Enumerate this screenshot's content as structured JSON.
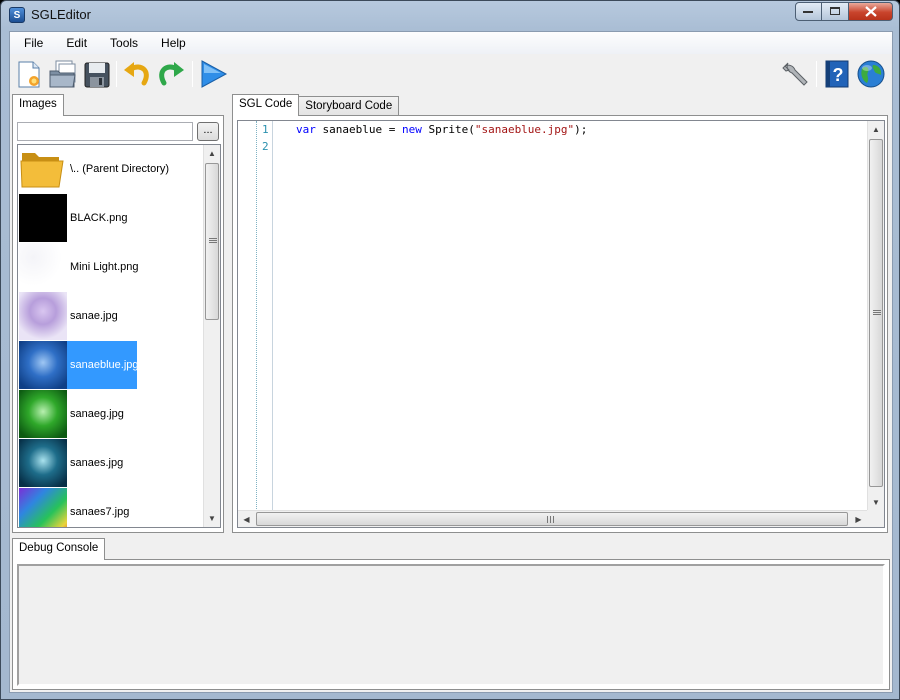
{
  "window": {
    "title": "SGLEditor"
  },
  "menubar": {
    "items": [
      "File",
      "Edit",
      "Tools",
      "Help"
    ]
  },
  "toolbar": {
    "buttons": [
      "new-file-icon",
      "open-folder-icon",
      "save-disk-icon",
      "undo-icon",
      "redo-icon",
      "run-play-icon"
    ],
    "right_buttons": [
      "wrench-icon",
      "help-book-icon",
      "globe-icon"
    ]
  },
  "images_panel": {
    "tab_label": "Images",
    "search_value": "",
    "browse_label": "...",
    "files": [
      {
        "name": "\\.. (Parent Directory)",
        "thumb": "folder"
      },
      {
        "name": "BLACK.png",
        "thumb": "black"
      },
      {
        "name": "Mini Light.png",
        "thumb": "light"
      },
      {
        "name": "sanae.jpg",
        "thumb": "sanae"
      },
      {
        "name": "sanaeblue.jpg",
        "thumb": "blue",
        "selected": true
      },
      {
        "name": "sanaeg.jpg",
        "thumb": "green"
      },
      {
        "name": "sanaes.jpg",
        "thumb": "teal"
      },
      {
        "name": "sanaes7.jpg",
        "thumb": "rainbow"
      }
    ]
  },
  "editor": {
    "tabs": [
      "SGL Code",
      "Storyboard Code"
    ],
    "active_tab": "SGL Code",
    "line_numbers": [
      "1",
      "2"
    ],
    "code": {
      "kw1": "var",
      "ident": " sanaeblue = ",
      "kw2": "new",
      "cls": " Sprite(",
      "str": "\"sanaeblue.jpg\"",
      "end": ");"
    }
  },
  "debug": {
    "tab_label": "Debug Console",
    "output": ""
  },
  "colors": {
    "selection": "#3399ff",
    "keyword": "#0000ff",
    "string": "#a31515",
    "line_number": "#2b91af"
  }
}
